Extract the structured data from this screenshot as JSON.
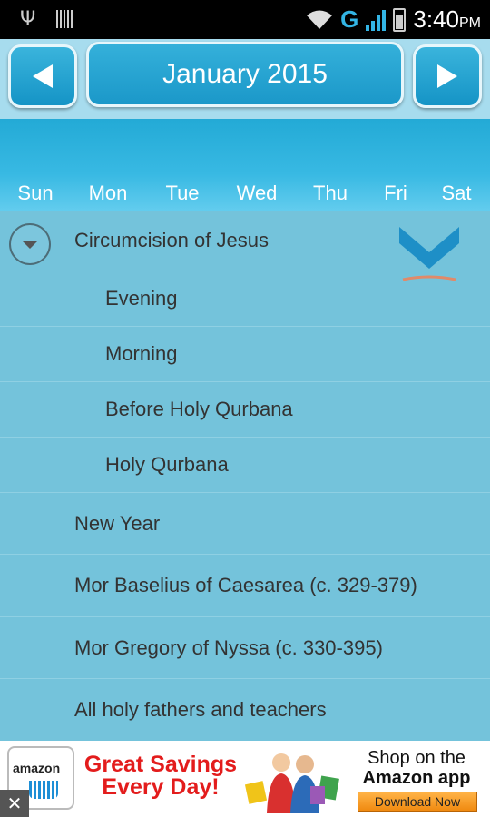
{
  "status_bar": {
    "time": "3:40",
    "ampm": "PM",
    "network_label": "G",
    "icons": [
      "usb-icon",
      "barcode-icon",
      "wifi-icon",
      "signal-icon",
      "battery-charging-icon"
    ]
  },
  "header": {
    "month_title": "January 2015",
    "prev_icon": "left-triangle-icon",
    "next_icon": "right-triangle-icon"
  },
  "weekdays": [
    "Sun",
    "Mon",
    "Tue",
    "Wed",
    "Thu",
    "Fri",
    "Sat"
  ],
  "events": [
    {
      "label": "Circumcision of Jesus",
      "level": 0,
      "expanded": true
    },
    {
      "label": "Evening",
      "level": 1
    },
    {
      "label": "Morning",
      "level": 1
    },
    {
      "label": "Before Holy Qurbana",
      "level": 1
    },
    {
      "label": "Holy Qurbana",
      "level": 1
    },
    {
      "label": "New Year",
      "level": 0
    },
    {
      "label": "Mor Baselius of Caesarea (c. 329-379)",
      "level": 0
    },
    {
      "label": "Mor Gregory of Nyssa (c. 330-395)",
      "level": 0
    },
    {
      "label": "All holy fathers and teachers",
      "level": 0
    }
  ],
  "ad": {
    "logo_text": "amazon",
    "headline_line1": "Great Savings",
    "headline_line2": "Every Day!",
    "shop_line1": "Shop on the",
    "shop_line2": "Amazon app",
    "button_label": "Download Now",
    "close_label": "✕"
  },
  "colors": {
    "header_bg": "#a7dcee",
    "button_blue": "#1b98c9",
    "list_bg": "#74c3db",
    "ad_red": "#e31c1c"
  }
}
